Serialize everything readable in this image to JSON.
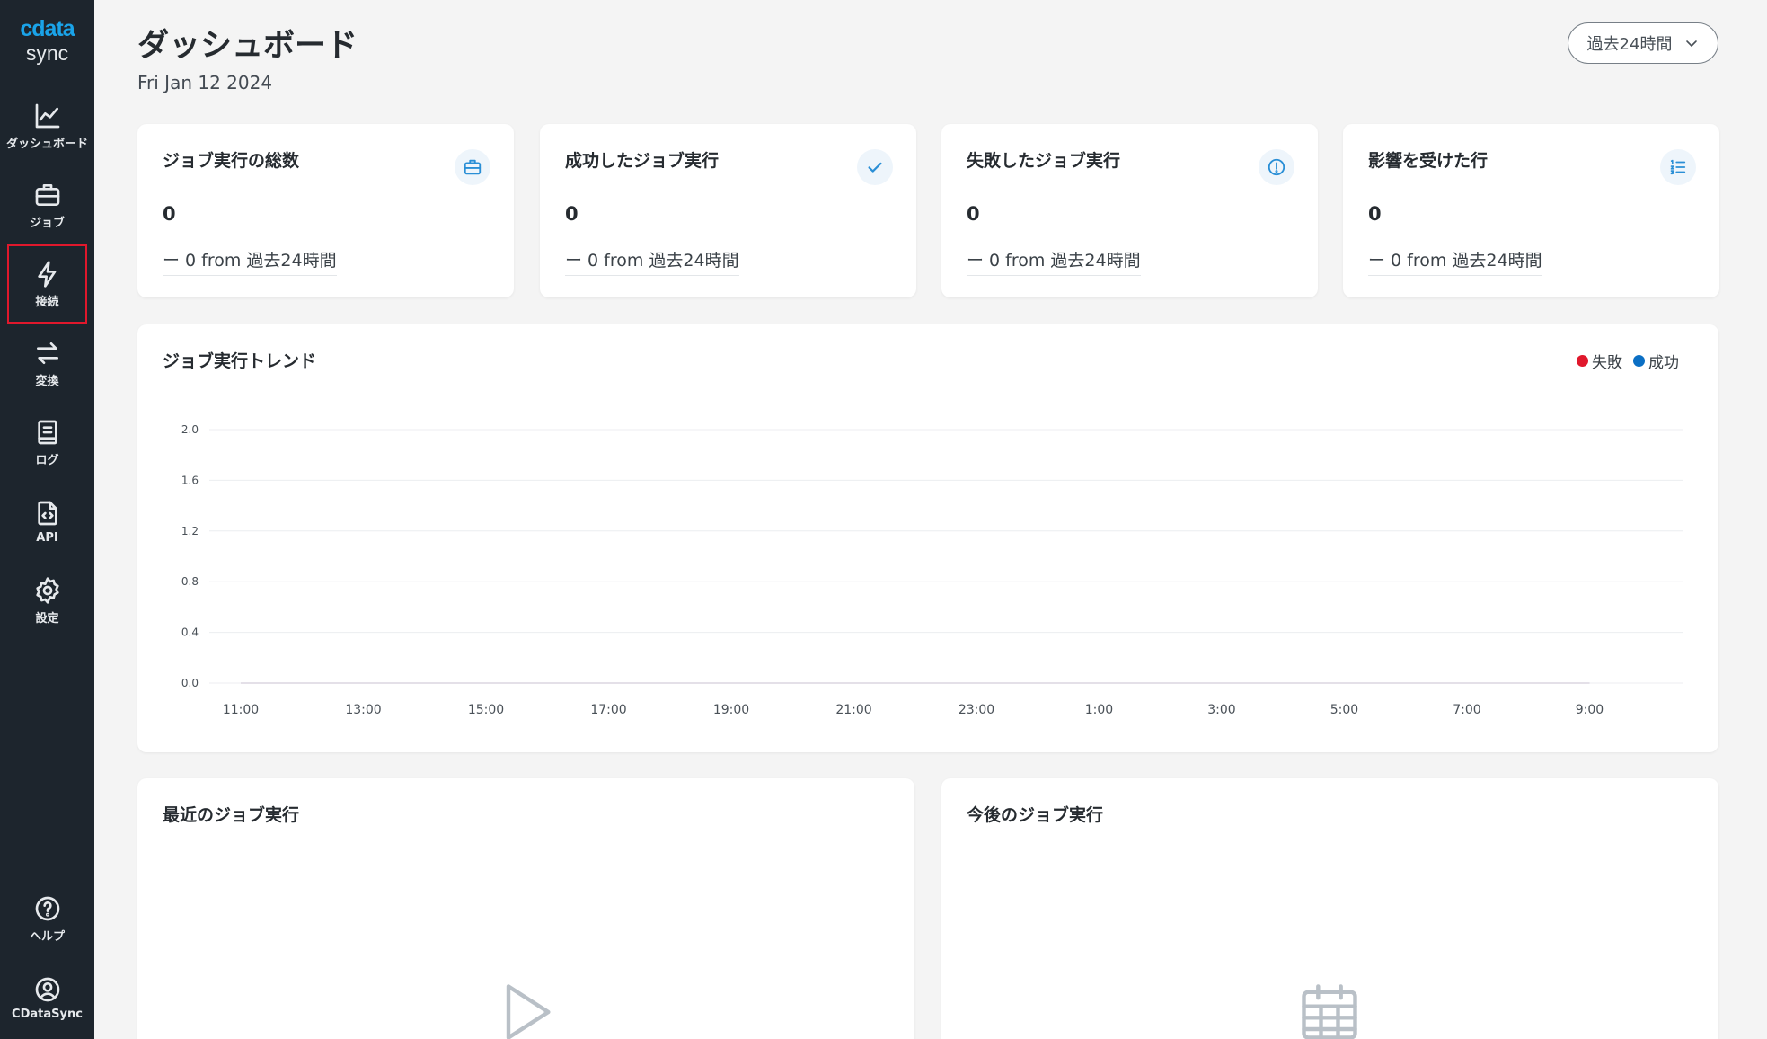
{
  "sidebar": {
    "logo_top": "cdata",
    "logo_bottom": "sync",
    "items": [
      {
        "label": "ダッシュボード",
        "icon": "chart-line-icon"
      },
      {
        "label": "ジョブ",
        "icon": "briefcase-icon"
      },
      {
        "label": "接続",
        "icon": "lightning-icon"
      },
      {
        "label": "変換",
        "icon": "arrows-swap-icon"
      },
      {
        "label": "ログ",
        "icon": "log-book-icon"
      },
      {
        "label": "API",
        "icon": "api-file-icon"
      },
      {
        "label": "設定",
        "icon": "gear-icon"
      }
    ],
    "bottom_items": [
      {
        "label": "ヘルプ",
        "icon": "help-circle-icon"
      },
      {
        "label": "CDataSync",
        "icon": "user-circle-icon"
      }
    ]
  },
  "header": {
    "title": "ダッシュボード",
    "date": "Fri Jan 12 2024",
    "range_select": "過去24時間"
  },
  "stats": [
    {
      "title": "ジョブ実行の総数",
      "value": "0",
      "delta": "ー 0 from 過去24時間",
      "icon": "briefcase-icon"
    },
    {
      "title": "成功したジョブ実行",
      "value": "0",
      "delta": "ー 0 from 過去24時間",
      "icon": "checkmark-icon"
    },
    {
      "title": "失敗したジョブ実行",
      "value": "0",
      "delta": "ー 0 from 過去24時間",
      "icon": "info-circle-icon"
    },
    {
      "title": "影響を受けた行",
      "value": "0",
      "delta": "ー 0 from 過去24時間",
      "icon": "numbered-list-icon"
    }
  ],
  "chart_card": {
    "title": "ジョブ実行トレンド",
    "legend": [
      {
        "label": "失敗",
        "color": "#e0182c"
      },
      {
        "label": "成功",
        "color": "#0b6fc4"
      }
    ]
  },
  "chart_data": {
    "type": "line",
    "x": [
      "11:00",
      "13:00",
      "15:00",
      "17:00",
      "19:00",
      "21:00",
      "23:00",
      "1:00",
      "3:00",
      "5:00",
      "7:00",
      "9:00"
    ],
    "yticks": [
      "0.0",
      "0.4",
      "0.8",
      "1.2",
      "1.6",
      "2.0"
    ],
    "ylim": [
      0,
      2.0
    ],
    "series": [
      {
        "name": "失敗",
        "values": [
          0,
          0,
          0,
          0,
          0,
          0,
          0,
          0,
          0,
          0,
          0,
          0
        ]
      },
      {
        "name": "成功",
        "values": [
          0,
          0,
          0,
          0,
          0,
          0,
          0,
          0,
          0,
          0,
          0,
          0
        ]
      }
    ],
    "grid": true,
    "legend": "top-right"
  },
  "recent_runs": {
    "title": "最近のジョブ実行",
    "icon": "play-icon"
  },
  "upcoming_runs": {
    "title": "今後のジョブ実行",
    "icon": "calendar-icon"
  },
  "colors": {
    "sidebar_bg": "#1d252d",
    "accent": "#1aa3e8",
    "icon_blue": "#2a8fd6",
    "highlight": "#e0182c"
  }
}
